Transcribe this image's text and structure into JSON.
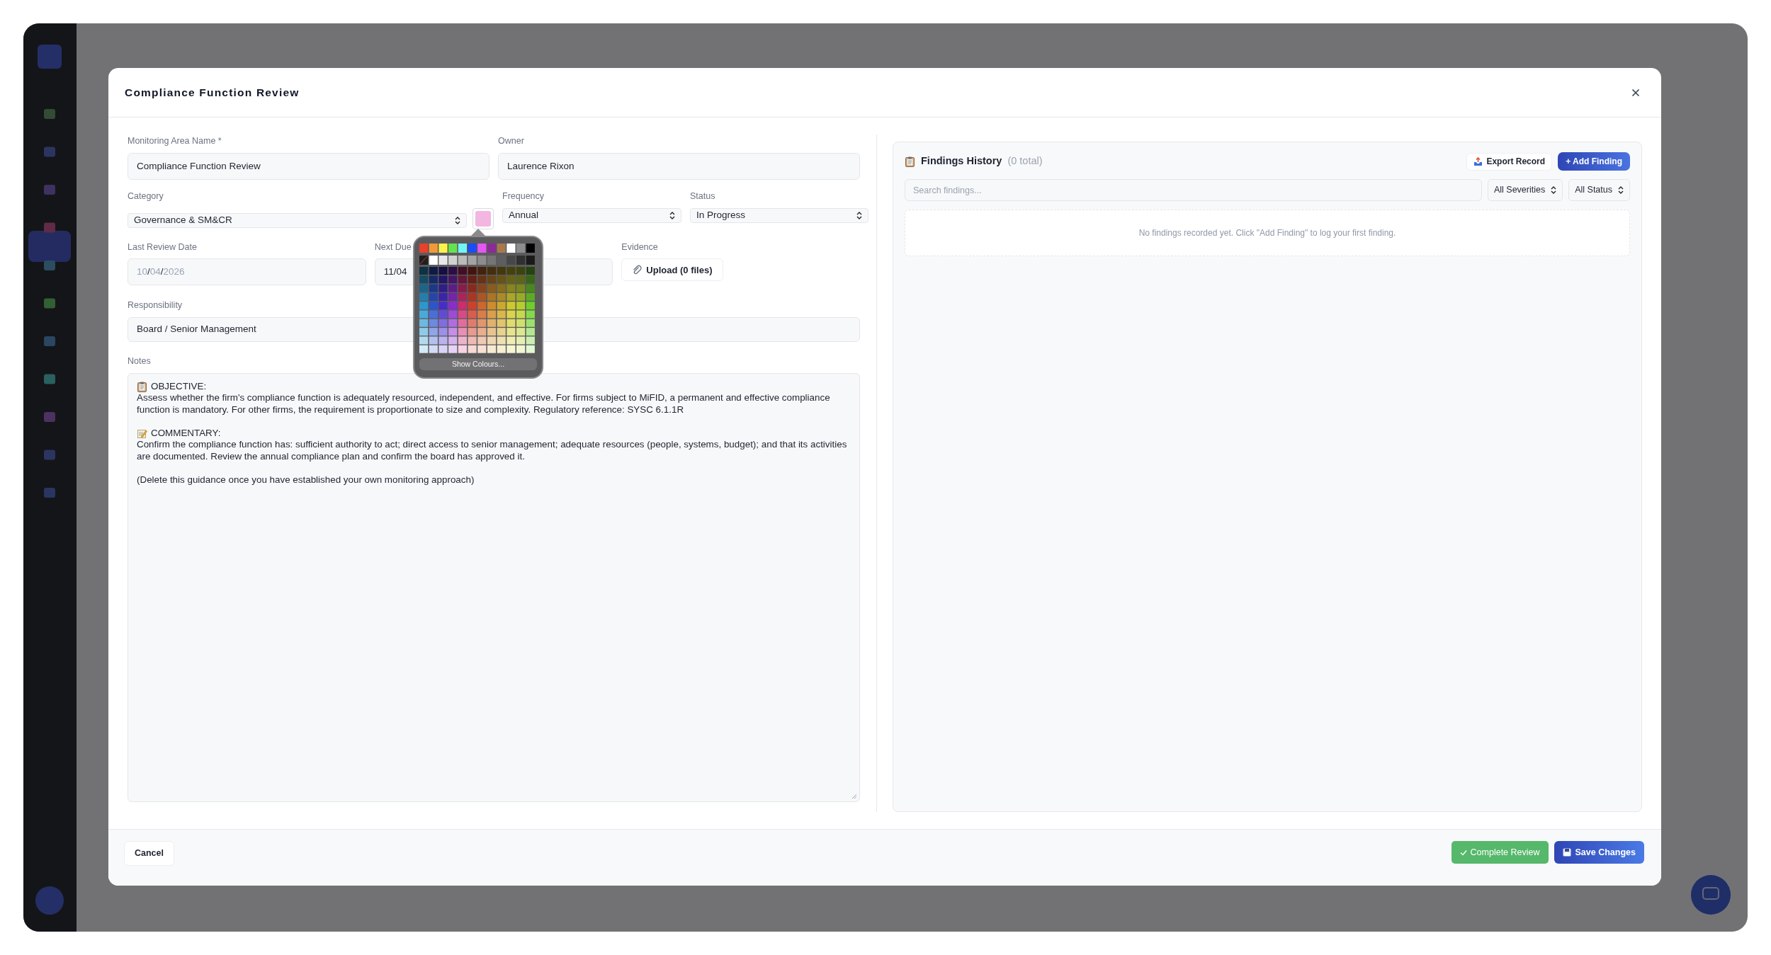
{
  "modal": {
    "title": "Compliance Function Review"
  },
  "name_field": {
    "label": "Monitoring Area Name *",
    "value": "Compliance Function Review"
  },
  "owner_field": {
    "label": "Owner",
    "value": "Laurence Rixon"
  },
  "category_field": {
    "label": "Category",
    "value": "Governance & SM&CR"
  },
  "frequency_field": {
    "label": "Frequency",
    "value": "Annual"
  },
  "status_field": {
    "label": "Status",
    "value": "In Progress"
  },
  "colour_picker": {
    "open": true,
    "button": "Show Colours..."
  },
  "last_review_field": {
    "label": "Last Review Date",
    "placeholder": "10/04/2026"
  },
  "next_due_field": {
    "label": "Next Due",
    "value": "11/04"
  },
  "evidence_field": {
    "label": "Evidence",
    "button": "Upload (0 files)"
  },
  "responsibility_field": {
    "label": "Responsibility",
    "value": "Board / Senior Management"
  },
  "notes_field": {
    "label": "Notes",
    "blocks": [
      {
        "kind": "clipboard-heading",
        "text": "OBJECTIVE:"
      },
      {
        "kind": "paragraph",
        "text": "Assess whether the firm's compliance function is adequately resourced, independent, and effective. For firms subject to MiFID, a permanent and effective compliance function is mandatory. For other firms, the requirement is proportionate to size and complexity. Regulatory reference: SYSC 6.1.1R"
      },
      {
        "kind": "memo-heading",
        "text": "COMMENTARY:"
      },
      {
        "kind": "paragraph",
        "text": "Confirm the compliance function has: sufficient authority to act; direct access to senior management; adequate resources (people, systems, budget); and that its activities are documented. Review the annual compliance plan and confirm the board has approved it."
      },
      {
        "kind": "paragraph",
        "text": "(Delete this guidance once you have established your own monitoring approach)"
      }
    ]
  },
  "findings": {
    "title": "Findings History",
    "count": "(0 total)",
    "export_button": "Export Record",
    "add_button": "+ Add Finding",
    "search": {
      "placeholder": "Search findings..."
    },
    "severity_filter": "All Severities",
    "status_filter": "All Status",
    "empty_message": "No findings recorded yet. Click \"Add Finding\" to log your first finding."
  },
  "footer": {
    "cancel": "Cancel",
    "complete": "Complete Review",
    "save": "Save Changes"
  }
}
